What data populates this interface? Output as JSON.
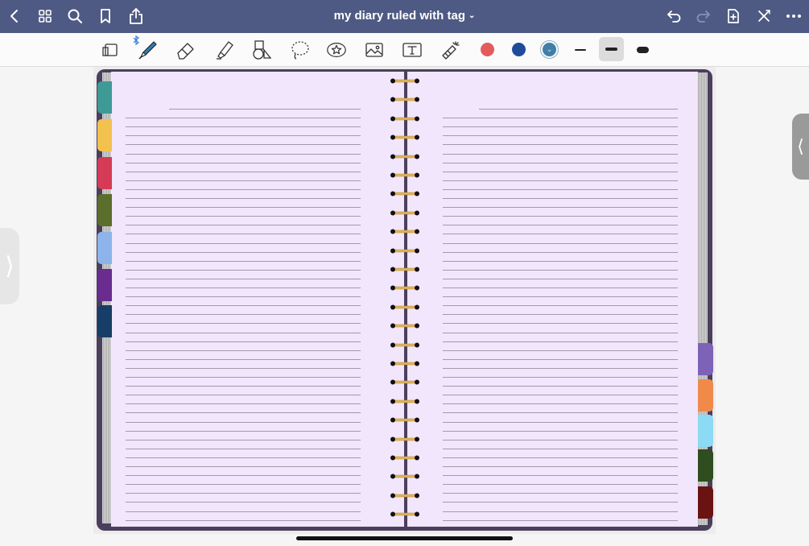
{
  "header": {
    "title": "my diary ruled with tag",
    "title_chevron": "⌄",
    "left_icons": [
      "back-icon",
      "grid-icon",
      "search-icon",
      "bookmark-icon",
      "share-icon"
    ],
    "right_icons": [
      "undo-icon",
      "redo-icon",
      "add-page-icon",
      "close-icon",
      "more-icon"
    ]
  },
  "toolbar": {
    "tools": [
      "sidebar-toggle-icon",
      "pen-icon",
      "eraser-icon",
      "highlighter-icon",
      "shapes-icon",
      "lasso-icon",
      "sticker-icon",
      "image-icon",
      "text-box-icon",
      "laser-pointer-icon"
    ],
    "selected_tool": "pen-icon",
    "bluetooth_indicator": "bluetooth-icon",
    "colors": [
      "#e45b5b",
      "#1f4b99",
      "#3f7fa8"
    ],
    "selected_color": "#3f7fa8",
    "stroke_widths": [
      "thin",
      "medium",
      "thick"
    ],
    "selected_width": "medium"
  },
  "notebook": {
    "left_tabs": [
      "#3e9a95",
      "#f2c14e",
      "#d63b55",
      "#5b6e2c",
      "#8db4ea",
      "#6a2c8f",
      "#173e66"
    ],
    "right_tabs": [
      "#7d62b7",
      "#f08a4b",
      "#8cdaf4",
      "#2f4d1e",
      "#6a1313"
    ],
    "paper_color": "#f1e6fb",
    "ruled_lines_per_page": 47,
    "spiral_rings": 24
  },
  "side_handles": {
    "left_glyph": "⟩",
    "right_glyph": "⟨"
  }
}
